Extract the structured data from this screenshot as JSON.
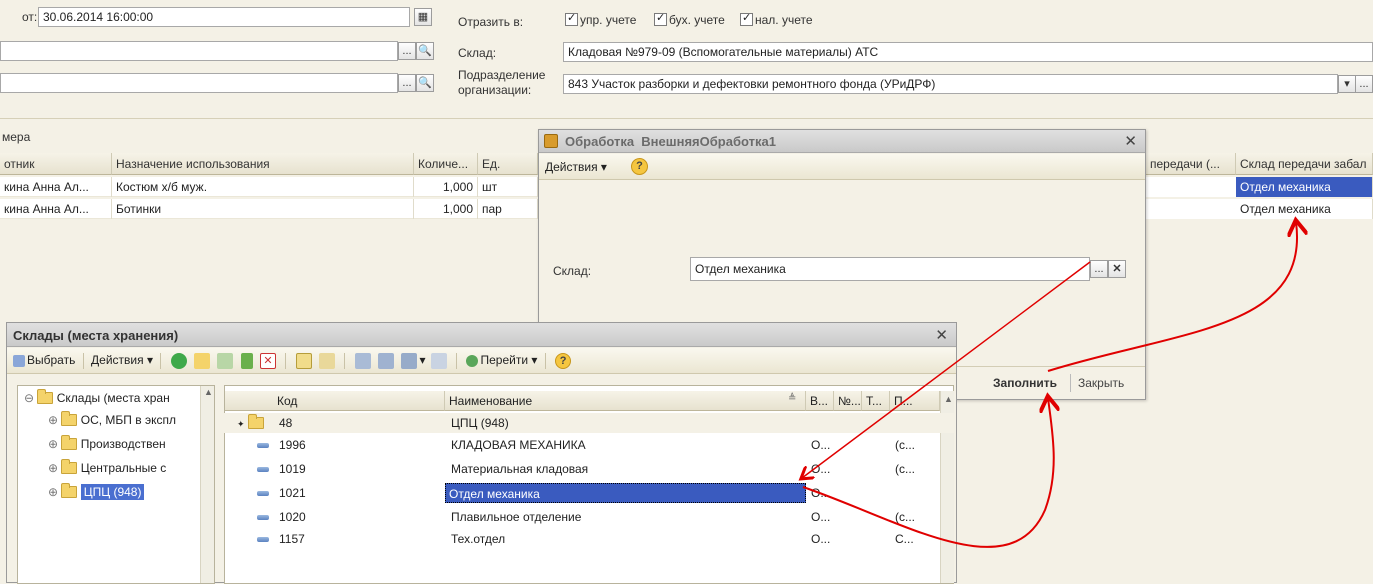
{
  "header": {
    "from_label": "от:",
    "date_value": "30.06.2014 16:00:00",
    "reflect_label": "Отразить в:",
    "checks": [
      "упр. учете",
      "бух. учете",
      "нал. учете"
    ],
    "warehouse_label": "Склад:",
    "warehouse_value": "Кладовая №979-09 (Вспомогательные материалы) АТС",
    "division_label_1": "Подразделение",
    "division_label_2": "организации:",
    "division_value": "843 Участок разборки и дефектовки ремонтного фонда (УРиДРФ)",
    "section_label": "мера"
  },
  "main_table": {
    "columns": [
      "отник",
      "Назначение использования",
      "Количе...",
      "Ед.",
      "передачи (...",
      "Склад передачи забал"
    ],
    "rows": [
      {
        "employee": "кина Анна Ал...",
        "purpose": "Костюм х/б муж.",
        "qty": "1,000",
        "unit": "шт",
        "store": "Отдел механика"
      },
      {
        "employee": "кина Анна Ал...",
        "purpose": "Ботинки",
        "qty": "1,000",
        "unit": "пар",
        "store": "Отдел механика"
      }
    ]
  },
  "dialog": {
    "title_1": "Обработка",
    "title_2": "ВнешняяОбработка1",
    "actions": "Действия",
    "warehouse_label": "Склад:",
    "warehouse_value": "Отдел механика",
    "fill_button": "Заполнить",
    "close_button": "Закрыть"
  },
  "warehouses": {
    "title": "Склады (места хранения)",
    "toolbar": {
      "select": "Выбрать",
      "actions": "Действия",
      "goto": "Перейти"
    },
    "tree": [
      "Склады (места хран",
      "ОС, МБП в экспл",
      "Производствен",
      "Центральные с",
      "ЦПЦ (948)"
    ],
    "columns": [
      "Код",
      "Наименование",
      "В...",
      "№...",
      "Т...",
      "П..."
    ],
    "rows": [
      {
        "code": "48",
        "name": "ЦПЦ (948)",
        "c1": "",
        "c4": ""
      },
      {
        "code": "1996",
        "name": "КЛАДОВАЯ МЕХАНИКА",
        "c1": "О...",
        "c4": "(с..."
      },
      {
        "code": "1019",
        "name": "Материальная кладовая",
        "c1": "О...",
        "c4": "(с..."
      },
      {
        "code": "1021",
        "name": "Отдел механика",
        "c1": "О...",
        "c4": ""
      },
      {
        "code": "1020",
        "name": "Плавильное отделение",
        "c1": "О...",
        "c4": "(с..."
      },
      {
        "code": "1157",
        "name": "Тех.отдел",
        "c1": "О...",
        "c4": "С..."
      }
    ]
  },
  "colors": {
    "selection": "#3a5bbf",
    "annotation_arrow": "#e00000"
  }
}
